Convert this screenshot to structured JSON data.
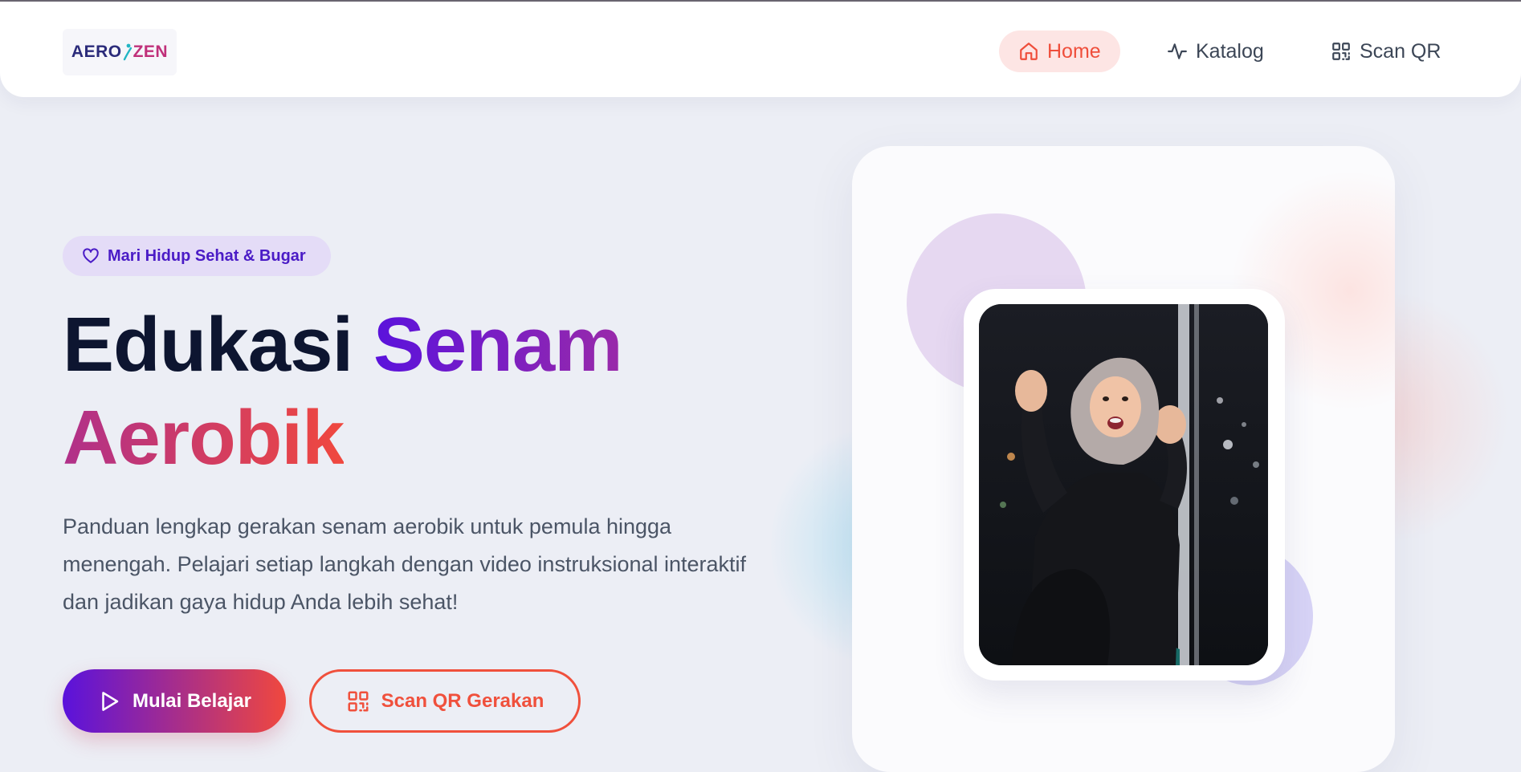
{
  "navbar": {
    "logo": {
      "part1": "AERO",
      "part2": "ZEN"
    },
    "items": [
      {
        "label": "Home",
        "icon": "home-icon",
        "active": true
      },
      {
        "label": "Katalog",
        "icon": "activity-icon",
        "active": false
      },
      {
        "label": "Scan QR",
        "icon": "qr-code-icon",
        "active": false
      }
    ]
  },
  "hero": {
    "badge": {
      "label": "Mari Hidup Sehat & Bugar",
      "icon": "heart-icon"
    },
    "title": {
      "part1": "Edukasi",
      "part2": "Senam",
      "part3": "Aerobik"
    },
    "description": "Panduan lengkap gerakan senam aerobik untuk pemula hingga menengah. Pelajari setiap langkah dengan video instruksional interaktif dan jadikan gaya hidup Anda lebih sehat!",
    "primary_button": {
      "label": "Mulai Belajar",
      "icon": "play-icon"
    },
    "secondary_button": {
      "label": "Scan QR Gerakan",
      "icon": "qr-code-icon"
    },
    "image_subject": "woman-in-hijab-waving-photo"
  },
  "colors": {
    "accent_purple": "#5a12dc",
    "accent_red": "#f0483e",
    "badge_bg": "#e4dcf7",
    "nav_active_bg": "#fde5e4",
    "text_dark": "#0d1530"
  }
}
